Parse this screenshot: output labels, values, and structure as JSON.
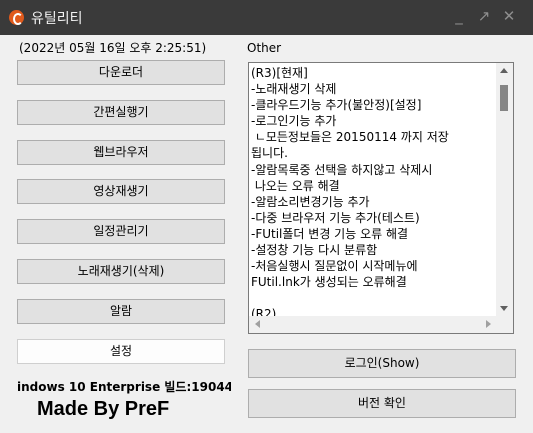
{
  "window": {
    "title": "유틸리티"
  },
  "left": {
    "datetime": "(2022년 05월 16일 오후 2:25:51)",
    "buttons": [
      "다운로더",
      "간편실행기",
      "웹브라우저",
      "영상재생기",
      "일정관리기",
      "노래재생기(삭제)",
      "알람",
      "설정"
    ],
    "sysinfo": "indows 10 Enterprise 빌드:19044",
    "madeby": "Made By PreF"
  },
  "right": {
    "group_label": "Other",
    "notes": "(R3)[현재]\n-노래재생기 삭제\n-클라우드기능 추가(불안정)[설정]\n-로그인기능 추가\n ㄴ모든정보들은 20150114 까지 저장\n됩니다.\n-알람목록중 선택을 하지않고 삭제시\n 나오는 오류 해결\n-알람소리변경기능 추가\n-다중 브라우저 기능 추가(테스트)\n-FUtil폴더 변경 기능 오류 해결\n-설정창 기능 다시 분류함\n-처음실행시 질문없이 시작메뉴에\nFUtil.lnk가 생성되는 오류해결\n\n(R2)",
    "login_button": "로그인(Show)",
    "version_button": "버전 확인"
  }
}
